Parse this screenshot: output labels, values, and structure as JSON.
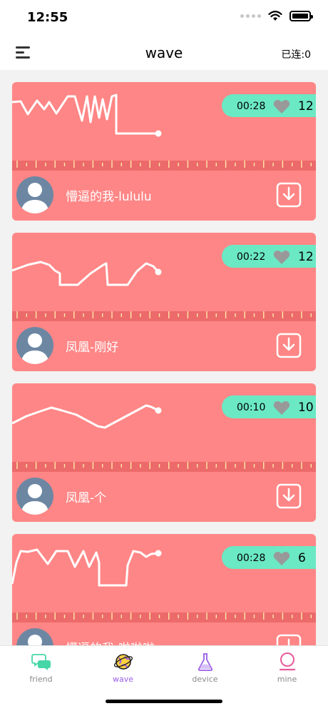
{
  "status_bar": {
    "time": "12:55"
  },
  "nav": {
    "title": "wave",
    "connected": "已连:0"
  },
  "cards": [
    {
      "duration": "00:28",
      "likes": "12",
      "title": "懵逼的我-lululu"
    },
    {
      "duration": "00:22",
      "likes": "12",
      "title": "凤凰-刚好"
    },
    {
      "duration": "00:10",
      "likes": "10",
      "title": "凤凰-个"
    },
    {
      "duration": "00:28",
      "likes": "6",
      "title": "懵逼的我-啦啦啦"
    }
  ],
  "tabs": [
    {
      "label": "friend",
      "icon": "chat-bubbles-icon"
    },
    {
      "label": "wave",
      "icon": "planet-icon"
    },
    {
      "label": "device",
      "icon": "flask-icon"
    },
    {
      "label": "mine",
      "icon": "user-icon"
    }
  ],
  "colors": {
    "card": "#ff8686",
    "ruler": "#ec6a6a",
    "pill": "#6be8c4",
    "active_tab": "#9b5de5",
    "avatar": "#6d87a3"
  }
}
